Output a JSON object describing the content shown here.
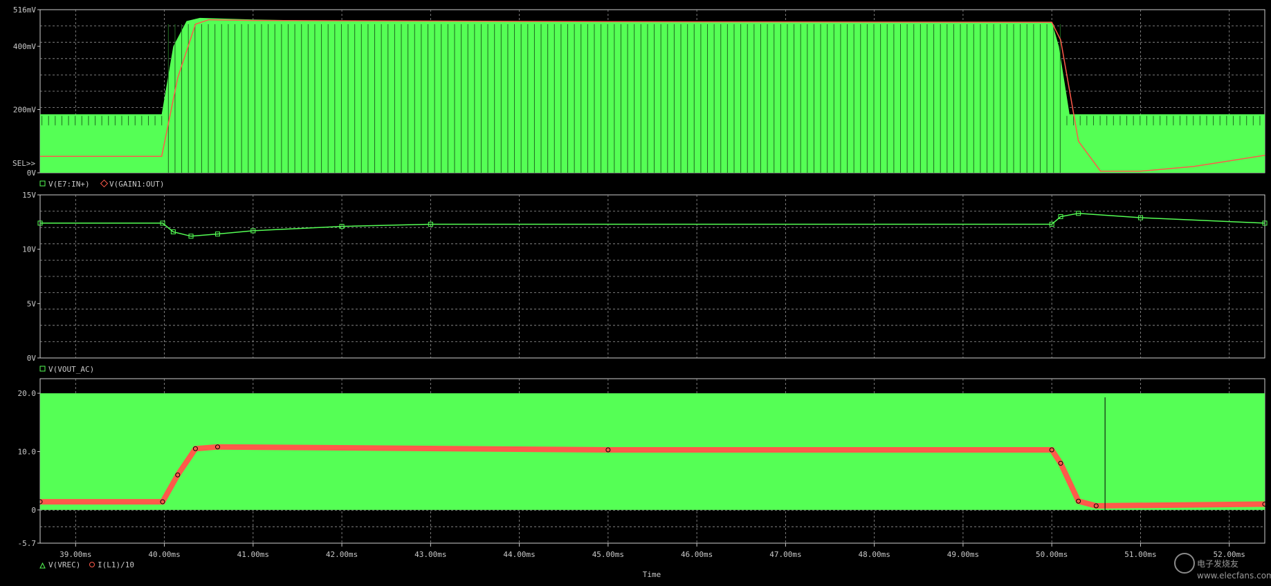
{
  "chart_data": [
    {
      "type": "line",
      "panel": "top",
      "ylim_mV": [
        0,
        516
      ],
      "y_ticks": [
        "516mV",
        "400mV",
        "200mV",
        "0V"
      ],
      "selector_label": "SEL>>",
      "legend": [
        {
          "marker": "square",
          "name": "V(E7:IN+)"
        },
        {
          "marker": "diamond",
          "name": "V(GAIN1:OUT)"
        }
      ],
      "series": [
        {
          "name": "V(E7:IN+)",
          "color": "#55ff55",
          "envelope_upper_mV": [
            [
              38.6,
              185
            ],
            [
              39.97,
              185
            ],
            [
              40.1,
              400
            ],
            [
              40.25,
              480
            ],
            [
              40.4,
              490
            ],
            [
              41.0,
              485
            ],
            [
              42,
              480
            ],
            [
              45,
              478
            ],
            [
              50.0,
              478
            ],
            [
              50.08,
              400
            ],
            [
              50.2,
              185
            ],
            [
              52.4,
              185
            ]
          ],
          "envelope_lower_mV": [
            [
              38.6,
              0
            ],
            [
              52.4,
              0
            ]
          ]
        },
        {
          "name": "V(GAIN1:OUT)",
          "color": "#ff5a4a",
          "points_mV": [
            [
              38.6,
              52
            ],
            [
              39.97,
              52
            ],
            [
              40.15,
              300
            ],
            [
              40.35,
              470
            ],
            [
              40.5,
              484
            ],
            [
              41,
              482
            ],
            [
              45,
              478
            ],
            [
              50.0,
              476
            ],
            [
              50.1,
              420
            ],
            [
              50.3,
              100
            ],
            [
              50.55,
              5
            ],
            [
              51.0,
              5
            ],
            [
              51.6,
              20
            ],
            [
              52.4,
              55
            ]
          ]
        }
      ]
    },
    {
      "type": "line",
      "panel": "middle",
      "ylim_V": [
        0,
        15
      ],
      "y_ticks": [
        "15V",
        "10V",
        "5V",
        "0V"
      ],
      "legend": [
        {
          "marker": "square",
          "name": "V(VOUT_AC)"
        }
      ],
      "series": [
        {
          "name": "V(VOUT_AC)",
          "color": "#55ff55",
          "points_V": [
            [
              38.6,
              12.4
            ],
            [
              39.98,
              12.4
            ],
            [
              40.1,
              11.6
            ],
            [
              40.3,
              11.2
            ],
            [
              40.6,
              11.4
            ],
            [
              41,
              11.7
            ],
            [
              42,
              12.1
            ],
            [
              43,
              12.3
            ],
            [
              50.0,
              12.3
            ],
            [
              50.1,
              13.0
            ],
            [
              50.3,
              13.3
            ],
            [
              51,
              12.9
            ],
            [
              52.4,
              12.4
            ]
          ]
        }
      ]
    },
    {
      "type": "line",
      "panel": "bottom",
      "ylim": [
        -5.7,
        22.5
      ],
      "y_ticks": [
        "20.0",
        "10.0",
        "0",
        "-5.7"
      ],
      "x_ticks": [
        "39.00ms",
        "40.00ms",
        "41.00ms",
        "42.00ms",
        "43.00ms",
        "44.00ms",
        "45.00ms",
        "46.00ms",
        "47.00ms",
        "48.00ms",
        "49.00ms",
        "50.00ms",
        "51.00ms",
        "52.00ms"
      ],
      "x_unit": "ms",
      "xlim_ms": [
        38.6,
        52.4
      ],
      "xlabel": "Time",
      "legend": [
        {
          "marker": "triangle",
          "name": "V(VREC)"
        },
        {
          "marker": "circle",
          "name": "I(L1)/10"
        }
      ],
      "series": [
        {
          "name": "V(VREC)",
          "color": "#55ff55",
          "envelope_upper": [
            [
              38.6,
              20
            ],
            [
              52.4,
              20
            ]
          ],
          "envelope_lower": [
            [
              38.6,
              0
            ],
            [
              52.4,
              0
            ]
          ]
        },
        {
          "name": "I(L1)/10",
          "color": "#ff5a4a",
          "points": [
            [
              38.6,
              1.4
            ],
            [
              39.98,
              1.4
            ],
            [
              40.15,
              6
            ],
            [
              40.35,
              10.5
            ],
            [
              40.6,
              10.8
            ],
            [
              45,
              10.3
            ],
            [
              50.0,
              10.3
            ],
            [
              50.1,
              8
            ],
            [
              50.3,
              1.5
            ],
            [
              50.5,
              0.7
            ],
            [
              52.4,
              1.0
            ]
          ]
        }
      ]
    }
  ],
  "watermark": {
    "title": "电子发烧友",
    "site": "www.elecfans.com"
  }
}
